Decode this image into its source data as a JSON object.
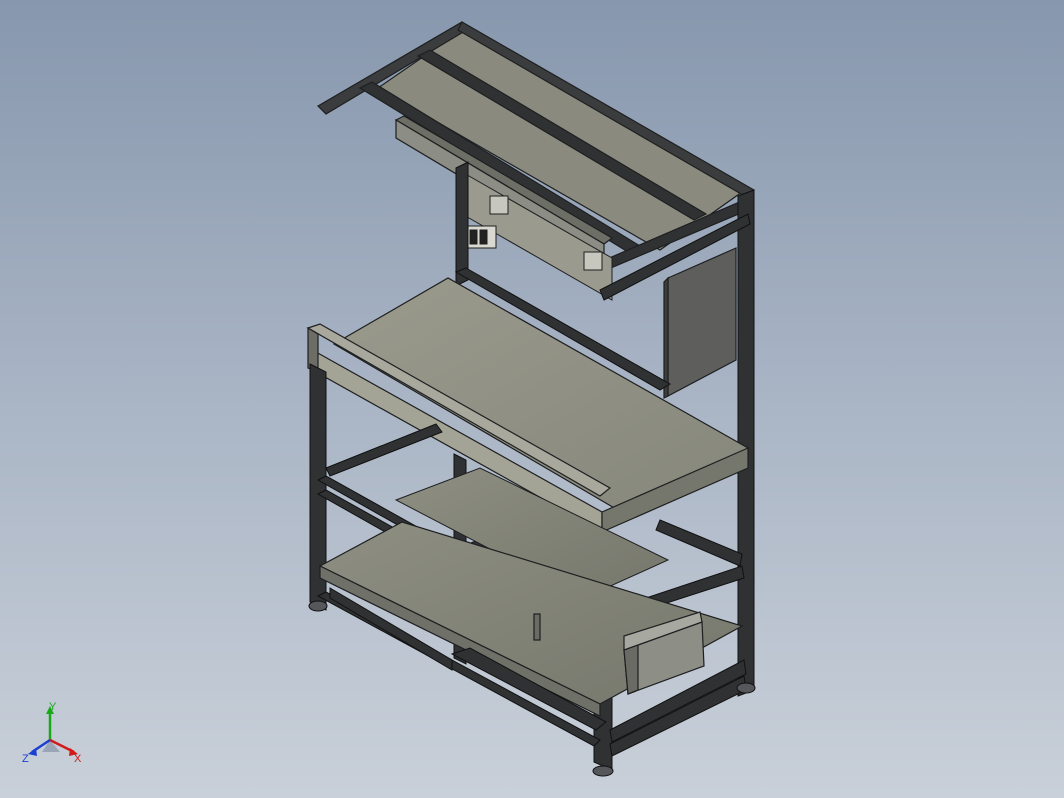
{
  "view": {
    "background_top": "#8797ad",
    "background_bottom": "#c9d0d9"
  },
  "model": {
    "description_icon": "workbench-3d-model-icon",
    "frame_color": "#2f3133",
    "panel_color": "#8b8b7e",
    "panel_light": "#a3a396",
    "panel_dark": "#5f605a"
  },
  "triad": {
    "x_label": "X",
    "y_label": "Y",
    "z_label": "Z",
    "x_color": "#d21a1a",
    "y_color": "#1aa81a",
    "z_color": "#1a3fd2"
  }
}
